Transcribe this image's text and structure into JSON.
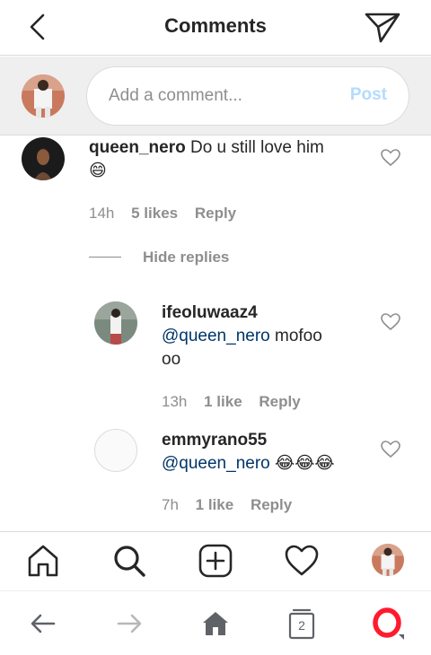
{
  "header": {
    "title": "Comments",
    "back_icon": "chevron-left-icon",
    "send_icon": "paper-plane-icon"
  },
  "compose": {
    "placeholder": "Add a comment...",
    "post_label": "Post"
  },
  "comments": [
    {
      "username": "queen_nero",
      "text": "Do u still love him",
      "emoji": "😄",
      "time": "14h",
      "likes": "5 likes",
      "reply": "Reply"
    },
    {
      "username": "ifeoluwaaz4",
      "mention": "@queen_nero",
      "text_line1": "mofoo",
      "text_line2": "oo",
      "time": "13h",
      "likes": "1 like",
      "reply": "Reply"
    },
    {
      "username": "emmyrano55",
      "mention": "@queen_nero",
      "emoji": "😂😂😂",
      "time": "7h",
      "likes": "1 like",
      "reply": "Reply"
    }
  ],
  "hide_replies": "Hide replies",
  "browser": {
    "tabs_count": "2"
  },
  "colors": {
    "mention": "#003569",
    "meta": "#8e8e8e",
    "post_disabled": "#b3dbff",
    "opera_red": "#ff1b2d"
  }
}
